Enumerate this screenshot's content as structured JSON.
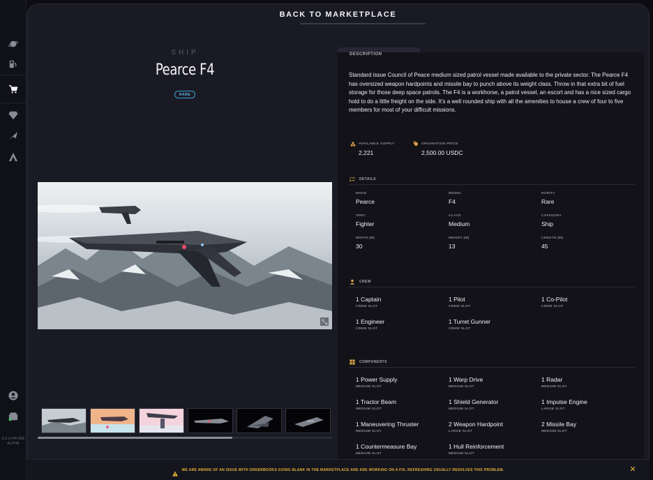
{
  "topbar": {
    "back_label": "BACK TO MARKETPLACE"
  },
  "rail": {
    "icons": [
      "planet-icon",
      "fuel-pump-icon",
      "cart-icon",
      "diamond-icon",
      "ship-icon",
      "atlas-icon",
      "user-icon",
      "wallet-icon"
    ],
    "version": [
      "0.0.0-PR-999",
      "ALPHA"
    ]
  },
  "ship": {
    "type": "SHIP",
    "name": "Pearce F4",
    "rarity": "RARE"
  },
  "panel": {
    "heading": "DESCRIPTION",
    "description": "Standard issue Council of Peace medium sized patrol vessel made available to the private sector. The Pearce F4 has oversized weapon hardpoints and missile bay to punch above its weight class. Throw in that extra bit of fuel storage for those deep space patrols. The F4 is a workhorse, a patrol vessel, an escort and has a nice sized cargo hold to do a little freight on the side. It's a well rounded ship with all the amenities to house a crew of four to five members for most of your difficult missions.",
    "supply": {
      "label": "AVAILABLE SUPPLY",
      "value": "2,221"
    },
    "price": {
      "label": "ORIGINATION PRICE",
      "value": "2,500.00 USDC"
    }
  },
  "details": {
    "heading": "DETAILS",
    "items": [
      {
        "k": "MAKE",
        "v": "Pearce"
      },
      {
        "k": "MODEL",
        "v": "F4"
      },
      {
        "k": "RARITY",
        "v": "Rare"
      },
      {
        "k": "SPEC",
        "v": "Fighter"
      },
      {
        "k": "CLASS",
        "v": "Medium"
      },
      {
        "k": "CATEGORY",
        "v": "Ship"
      },
      {
        "k": "WIDTH (M)",
        "v": "30"
      },
      {
        "k": "HEIGHT (M)",
        "v": "13"
      },
      {
        "k": "LENGTH (M)",
        "v": "45"
      }
    ]
  },
  "crew": {
    "heading": "CREW",
    "items": [
      {
        "v": "1 Captain",
        "k": "CREW SLOT"
      },
      {
        "v": "1 Pilot",
        "k": "CREW SLOT"
      },
      {
        "v": "1 Co-Pilot",
        "k": "CREW SLOT"
      },
      {
        "v": "1 Engineer",
        "k": "CREW SLOT"
      },
      {
        "v": "1 Turret Gunner",
        "k": "CREW SLOT"
      }
    ]
  },
  "components": {
    "heading": "COMPONENTS",
    "items": [
      {
        "v": "1 Power Supply",
        "k": "MEDIUM SLOT"
      },
      {
        "v": "1 Warp Drive",
        "k": "MEDIUM SLOT"
      },
      {
        "v": "1 Radar",
        "k": "MEDIUM SLOT"
      },
      {
        "v": "1 Tractor Beam",
        "k": "MEDIUM SLOT"
      },
      {
        "v": "1 Shield Generator",
        "k": "MEDIUM SLOT"
      },
      {
        "v": "1 Impulse Engine",
        "k": "LARGE SLOT"
      },
      {
        "v": "1 Maneuvering Thruster",
        "k": "MEDIUM SLOT"
      },
      {
        "v": "2 Weapon Hardpoint",
        "k": "LARGE SLOT"
      },
      {
        "v": "2 Missile Bay",
        "k": "MEDIUM SLOT"
      },
      {
        "v": "1 Countermeasure Bay",
        "k": "MEDIUM SLOT"
      },
      {
        "v": "1 Hull Reinforcement",
        "k": "MEDIUM SLOT"
      }
    ]
  },
  "gallery": {
    "thumbnail_count": 6,
    "scroll_fraction": 0.66
  },
  "banner": {
    "message": "WE ARE AWARE OF AN ISSUE WITH ORDERBOOKS GOING BLANK IN THE MARKETPLACE AND ARE WORKING ON A FIX. REFRESHING USUALLY RESOLVES THIS PROBLEM.",
    "close": "✕"
  },
  "colors": {
    "accent": "#d9a54a",
    "rarity": "#3fa3d6",
    "warning": "#e8b53b"
  }
}
